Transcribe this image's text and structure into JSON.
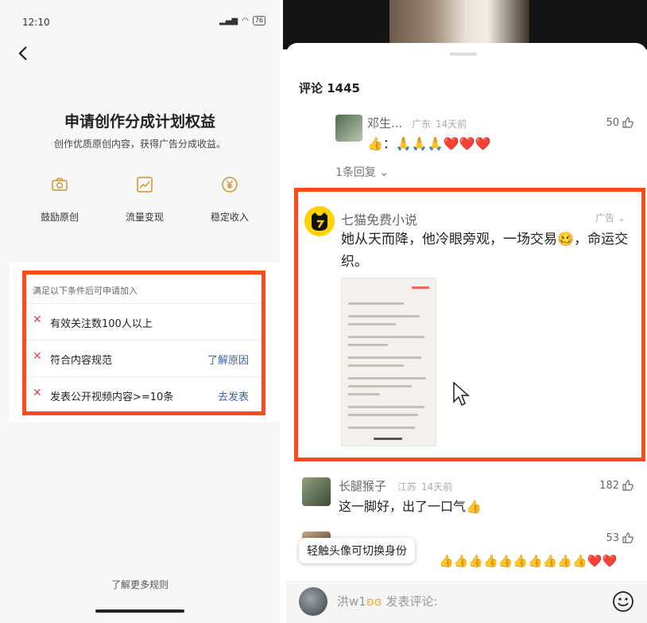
{
  "status": {
    "time": "12:10",
    "battery": "76"
  },
  "left": {
    "title": "申请创作分成计划权益",
    "subtitle": "创作优质原创内容，获得广告分成收益。",
    "benefits": [
      {
        "label": "鼓励原创",
        "icon": "camera-icon"
      },
      {
        "label": "流量变现",
        "icon": "trend-chart-icon"
      },
      {
        "label": "稳定收入",
        "icon": "yen-coin-icon"
      }
    ],
    "requirements": {
      "heading": "满足以下条件后可申请加入",
      "items": [
        {
          "text": "有效关注数100人以上",
          "action": ""
        },
        {
          "text": "符合内容规范",
          "action": "了解原因"
        },
        {
          "text": "发表公开视频内容>=10条",
          "action": "去发表"
        }
      ]
    },
    "more_rules": "了解更多规则"
  },
  "right": {
    "comments_title": "评论 1445",
    "comment1": {
      "name": "邓生...",
      "location": "广东",
      "time": "14天前",
      "likes": "50",
      "body_prefix": "👍：🙏🙏🙏❤️❤️❤️",
      "replies": "1条回复"
    },
    "ad": {
      "name": "七猫免费小说",
      "tag": "广告",
      "text": "她从天而降，他冷眼旁观，一场交易🥴，命运交织。"
    },
    "comment2": {
      "name": "长腿猴子",
      "location": "江苏",
      "time": "14天前",
      "likes": "182",
      "body": "这一脚好，出了一口气👍"
    },
    "comment3": {
      "likes": "53",
      "body": "👍👍👍👍👍👍👍👍👍👍❤️❤️"
    },
    "tooltip": "轻触头像可切换身份",
    "input": {
      "name_prefix": "洪w1",
      "placeholder": "发表评论:"
    }
  },
  "colors": {
    "highlight": "#ff4a1c",
    "link": "#3a64b0",
    "cross": "#e04848"
  }
}
